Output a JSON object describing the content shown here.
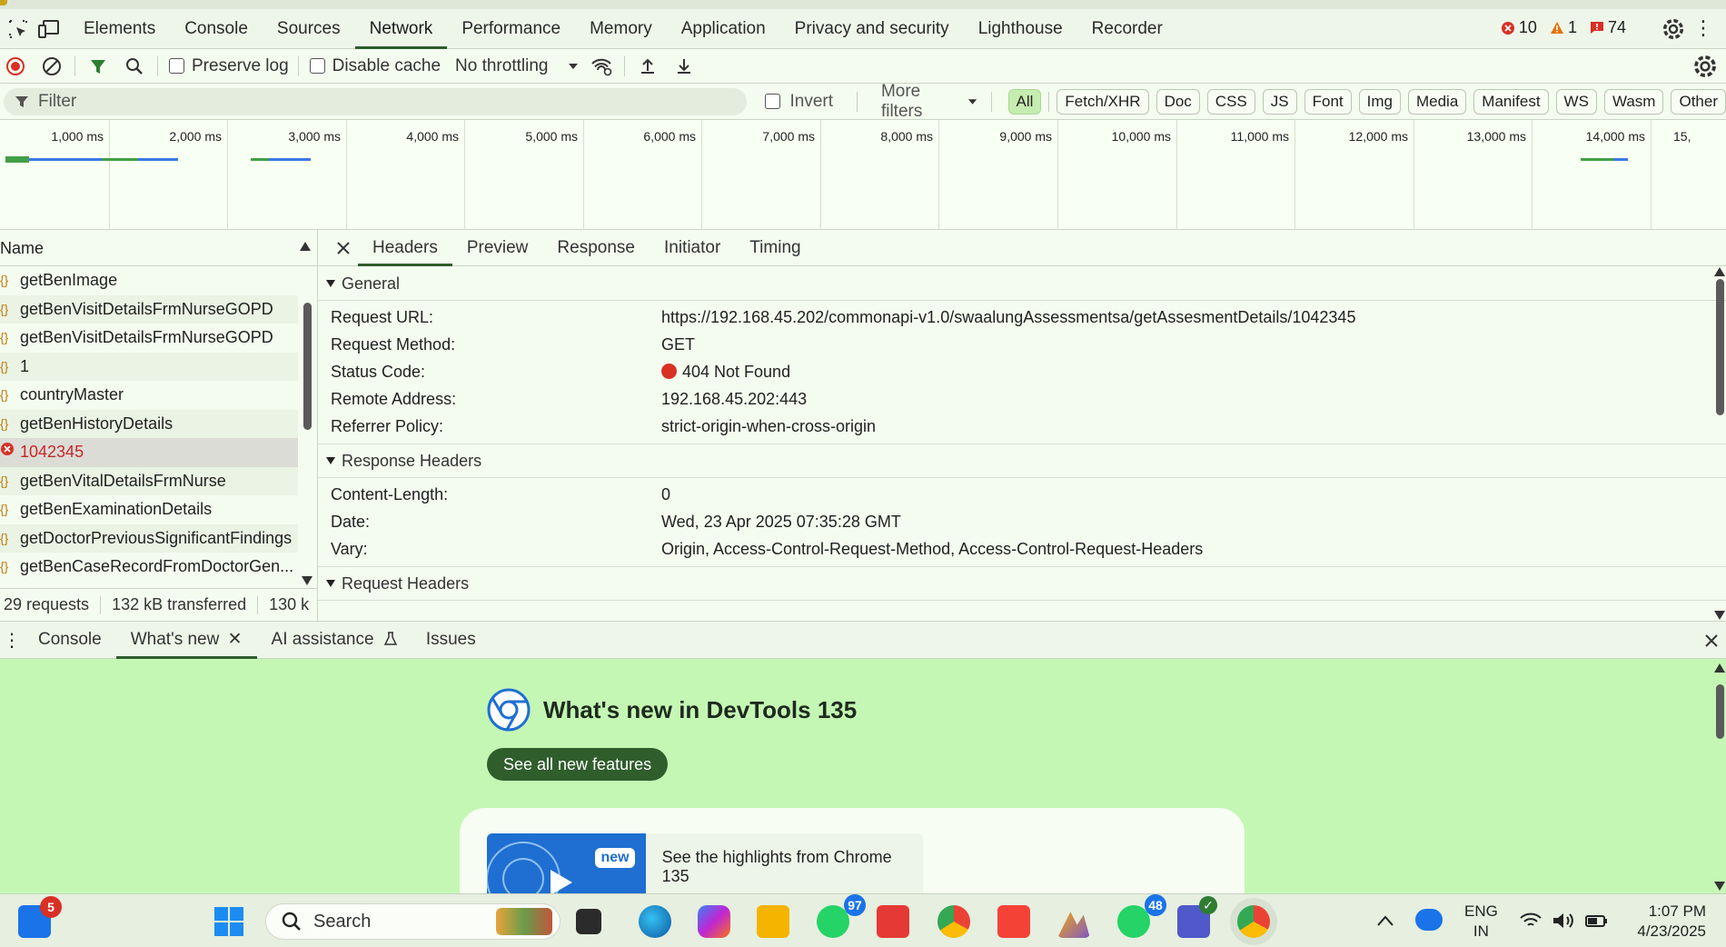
{
  "tabbar": {
    "tabs": [
      "Elements",
      "Console",
      "Sources",
      "Network",
      "Performance",
      "Memory",
      "Application",
      "Privacy and security",
      "Lighthouse",
      "Recorder"
    ],
    "active": "Network",
    "errors": "10",
    "warnings": "1",
    "issues": "74"
  },
  "toolbar": {
    "preserve_log": "Preserve log",
    "disable_cache": "Disable cache",
    "throttling": "No throttling"
  },
  "filter": {
    "placeholder": "Filter",
    "invert": "Invert",
    "more_filters": "More filters",
    "chips": [
      "All",
      "Fetch/XHR",
      "Doc",
      "CSS",
      "JS",
      "Font",
      "Img",
      "Media",
      "Manifest",
      "WS",
      "Wasm",
      "Other"
    ]
  },
  "timeline": {
    "ticks": [
      "1,000 ms",
      "2,000 ms",
      "3,000 ms",
      "4,000 ms",
      "5,000 ms",
      "6,000 ms",
      "7,000 ms",
      "8,000 ms",
      "9,000 ms",
      "10,000 ms",
      "11,000 ms",
      "12,000 ms",
      "13,000 ms",
      "14,000 ms",
      "15,"
    ]
  },
  "requests": {
    "header": "Name",
    "items": [
      "getBenImage",
      "getBenVisitDetailsFrmNurseGOPD",
      "getBenVisitDetailsFrmNurseGOPD",
      "1",
      "countryMaster",
      "getBenHistoryDetails",
      "1042345",
      "getBenVitalDetailsFrmNurse",
      "getBenExaminationDetails",
      "getDoctorPreviousSignificantFindings",
      "getBenCaseRecordFromDoctorGen..."
    ],
    "error_item": "1042345",
    "summary_requests": "29 requests",
    "summary_transferred": "132 kB transferred",
    "summary_resources": "130 k"
  },
  "details": {
    "tabs": [
      "Headers",
      "Preview",
      "Response",
      "Initiator",
      "Timing"
    ],
    "active": "Headers",
    "general": {
      "title": "General",
      "rows": [
        {
          "k": "Request URL:",
          "v": "https://192.168.45.202/commonapi-v1.0/swaalungAssessmentsa/getAssesmentDetails/1042345"
        },
        {
          "k": "Request Method:",
          "v": "GET"
        },
        {
          "k": "Status Code:",
          "v": "404 Not Found"
        },
        {
          "k": "Remote Address:",
          "v": "192.168.45.202:443"
        },
        {
          "k": "Referrer Policy:",
          "v": "strict-origin-when-cross-origin"
        }
      ]
    },
    "response_headers": {
      "title": "Response Headers",
      "rows": [
        {
          "k": "Content-Length:",
          "v": "0"
        },
        {
          "k": "Date:",
          "v": "Wed, 23 Apr 2025 07:35:28 GMT"
        },
        {
          "k": "Vary:",
          "v": "Origin, Access-Control-Request-Method, Access-Control-Request-Headers"
        }
      ]
    },
    "request_headers": {
      "title": "Request Headers"
    }
  },
  "drawer": {
    "tabs": [
      "Console",
      "What's new",
      "AI assistance",
      "Issues"
    ],
    "active": "What's new",
    "title": "What's new in DevTools 135",
    "button": "See all new features",
    "highlight_badge": "new",
    "highlight_text": "See the highlights from Chrome 135"
  },
  "taskbar": {
    "search": "Search",
    "badge_widgets": "5",
    "badge_whatsapp": "97",
    "badge_whatsapp2": "48",
    "lang_top": "ENG",
    "lang_bottom": "IN",
    "time": "1:07 PM",
    "date": "4/23/2025"
  }
}
